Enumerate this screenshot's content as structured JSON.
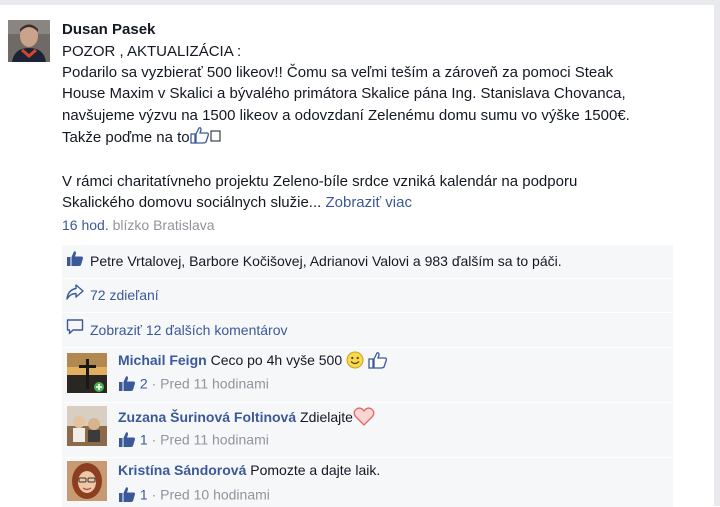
{
  "post": {
    "author": "Dusan Pasek",
    "lines": [
      "POZOR , AKTUALIZÁCIA :",
      "Podarilo sa vyzbierať 500 likeov!! Čomu sa veľmi teším a zároveň za pomoci Steak",
      "House Maxim v Skalici a bývalého primátora Skalice pána Ing. Stanislava Chovanca,",
      "navšujeme výzvu na 1500 likeov a odovzdaní Zelenému domu sumu vo výške 1500€.",
      "Takže poďme na to"
    ],
    "para2_line1": "V rámci charitatívneho projektu Zeleno-bíle srdce vzniká kalendár na podporu",
    "para2_line2": "Skalického domovu sociálnych služie...",
    "see_more": "Zobraziť viac",
    "time": "16 hod.",
    "location": "blízko Bratislava"
  },
  "likes_text": "Petre Vrtalovej, Barbore Kočišovej, Adrianovi Valovi a 983 ďalším sa to páči.",
  "shares_text": "72 zdieľaní",
  "more_comments_text": "Zobraziť 12 ďalších komentárov",
  "comments": [
    {
      "name": "Michail Feign",
      "text": "Ceco po 4h vyše 500",
      "likes": "1",
      "likes_label": "2",
      "time": "Pred 11 hodinami"
    },
    {
      "name": "Zuzana Šurinová Foltinová",
      "text": "Zdielajte",
      "likes_label": "1",
      "time": "Pred 11 hodinami"
    },
    {
      "name": "Kristína Sándorová",
      "text": "Pomozte a dajte laik.",
      "likes_label": "1",
      "time": "Pred 10 hodinami"
    }
  ],
  "colors": {
    "link": "#3b5998",
    "bar": "#f6f7f9",
    "muted": "#90949c"
  }
}
